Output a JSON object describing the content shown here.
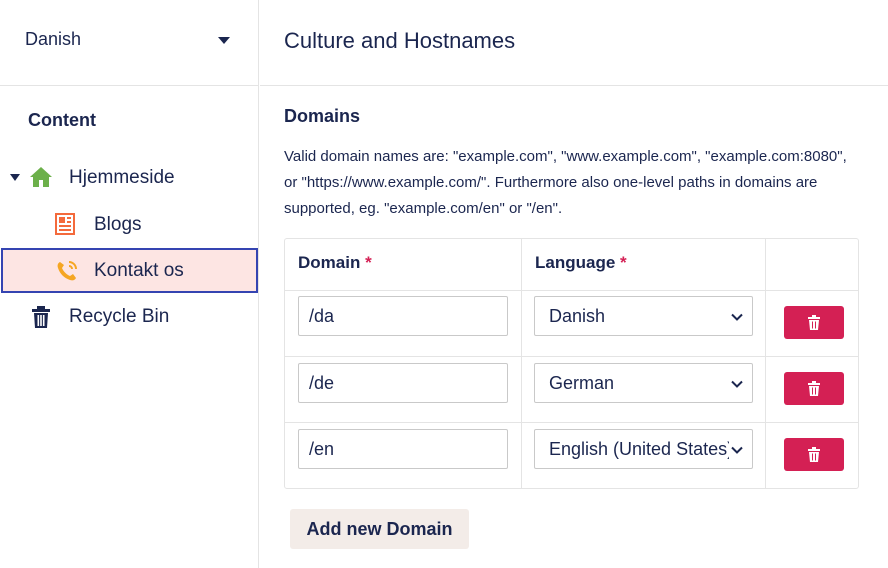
{
  "sidebar": {
    "language_selector": {
      "value": "Danish"
    },
    "section_title": "Content",
    "tree": [
      {
        "label": "Hjemmeside",
        "icon": "home-icon",
        "icon_color": "#6cb04a"
      },
      {
        "label": "Blogs",
        "icon": "newspaper-icon",
        "icon_color": "#f46a3c"
      },
      {
        "label": "Kontakt os",
        "icon": "phone-icon",
        "icon_color": "#f5a623",
        "selected": true
      },
      {
        "label": "Recycle Bin",
        "icon": "trash-icon",
        "icon_color": "#1b264f"
      }
    ]
  },
  "main": {
    "title": "Culture and Hostnames",
    "domains_title": "Domains",
    "description": "Valid domain names are: \"example.com\", \"www.example.com\", \"example.com:8080\", or \"https://www.example.com/\". Furthermore also one-level paths in domains are supported, eg. \"example.com/en\" or \"/en\".",
    "table": {
      "headers": {
        "domain": "Domain",
        "language": "Language",
        "required_marker": "*"
      },
      "rows": [
        {
          "domain": "/da",
          "language": "Danish"
        },
        {
          "domain": "/de",
          "language": "German"
        },
        {
          "domain": "/en",
          "language": "English (United States)"
        }
      ]
    },
    "add_button_label": "Add new Domain"
  },
  "colors": {
    "primary_text": "#1b264f",
    "danger": "#d42054",
    "selected_bg": "#fde5e3",
    "selected_border": "#3544b1",
    "secondary_button_bg": "#f3ece8"
  }
}
